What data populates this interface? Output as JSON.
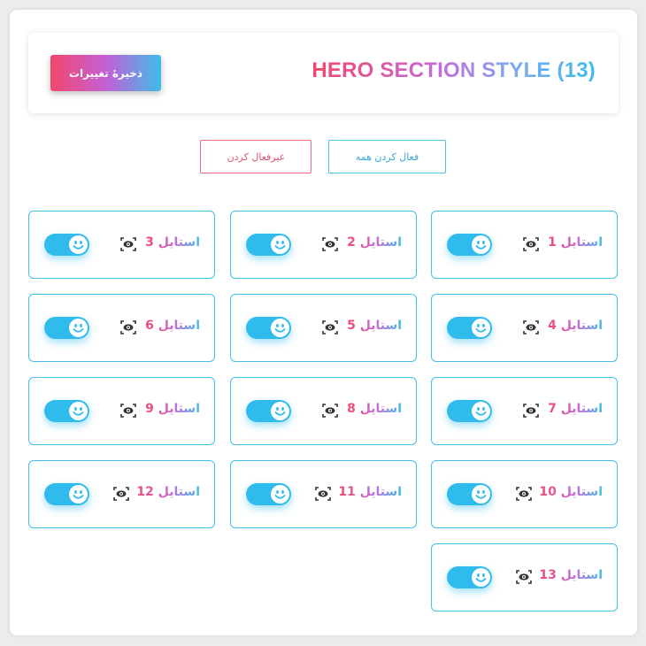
{
  "header": {
    "title": "HERO SECTION STYLE (13)",
    "save_label": "ذخیرهٔ تغییرات"
  },
  "actions": {
    "enable_all": "فعال کردن همه",
    "disable_all": "غیرفعال کردن"
  },
  "colors": {
    "accent_blue": "#2fbbec",
    "accent_pink": "#f2476a",
    "accent_purple": "#c45fd6"
  },
  "styles": [
    {
      "label": "استایل",
      "number": "1",
      "enabled": true,
      "icons": [
        "eye-icon",
        "smiley-icon"
      ]
    },
    {
      "label": "استایل",
      "number": "2",
      "enabled": true,
      "icons": [
        "eye-icon",
        "smiley-icon"
      ]
    },
    {
      "label": "استایل",
      "number": "3",
      "enabled": true,
      "icons": [
        "eye-icon",
        "smiley-icon"
      ]
    },
    {
      "label": "استایل",
      "number": "4",
      "enabled": true,
      "icons": [
        "eye-icon",
        "smiley-icon"
      ]
    },
    {
      "label": "استایل",
      "number": "5",
      "enabled": true,
      "icons": [
        "eye-icon",
        "smiley-icon"
      ]
    },
    {
      "label": "استایل",
      "number": "6",
      "enabled": true,
      "icons": [
        "eye-icon",
        "smiley-icon"
      ]
    },
    {
      "label": "استایل",
      "number": "7",
      "enabled": true,
      "icons": [
        "eye-icon",
        "smiley-icon"
      ]
    },
    {
      "label": "استایل",
      "number": "8",
      "enabled": true,
      "icons": [
        "eye-icon",
        "smiley-icon"
      ]
    },
    {
      "label": "استایل",
      "number": "9",
      "enabled": true,
      "icons": [
        "eye-icon",
        "smiley-icon"
      ]
    },
    {
      "label": "استایل",
      "number": "10",
      "enabled": true,
      "icons": [
        "eye-icon",
        "smiley-icon"
      ]
    },
    {
      "label": "استایل",
      "number": "11",
      "enabled": true,
      "icons": [
        "eye-icon",
        "smiley-icon"
      ]
    },
    {
      "label": "استایل",
      "number": "12",
      "enabled": true,
      "icons": [
        "eye-icon",
        "smiley-icon"
      ]
    },
    {
      "label": "استایل",
      "number": "13",
      "enabled": true,
      "icons": [
        "eye-icon",
        "smiley-icon"
      ]
    }
  ]
}
